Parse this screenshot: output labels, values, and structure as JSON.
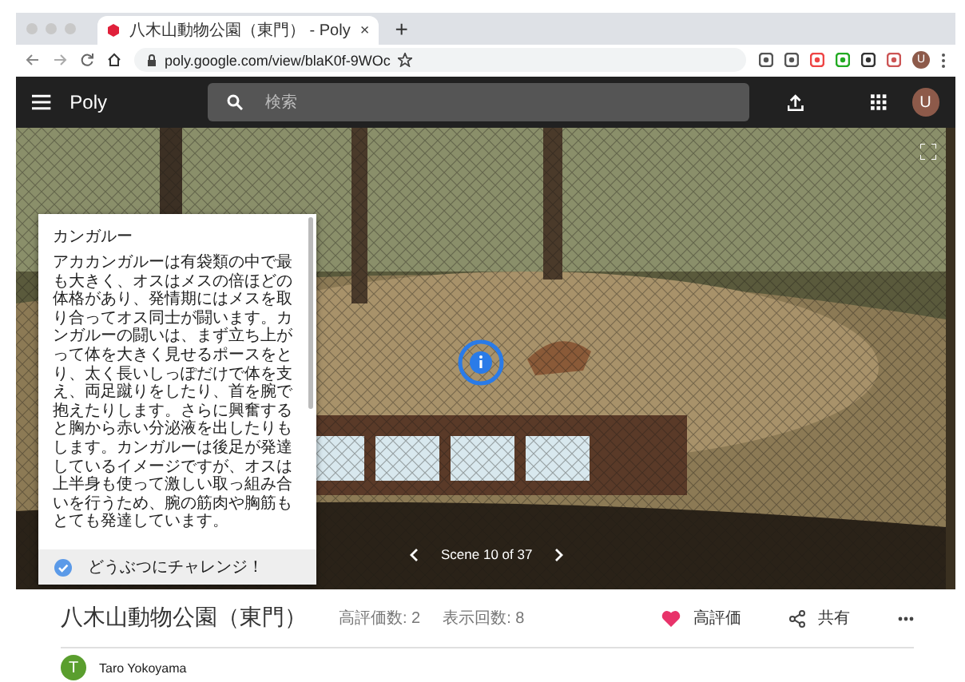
{
  "browser": {
    "tab_title": "八木山動物公園（東門） - Poly",
    "tab_close": "×",
    "new_tab": "+",
    "url": "poly.google.com/view/blaK0f-9WOc",
    "profile_initial": "U"
  },
  "app": {
    "name": "Poly",
    "search": {
      "placeholder": "検索"
    },
    "avatar_initial": "U"
  },
  "viewer": {
    "info_panel": {
      "title": "カンガルー",
      "body": "アカカンガルーは有袋類の中で最も大きく、オスはメスの倍ほどの体格があり、発情期にはメスを取り合ってオス同士が闘います。カンガルーの闘いは、まず立ち上がって体を大きく見せるポースをとり、太く長いしっぽだけで体を支え、両足蹴りをしたり、首を腕で抱えたりします。さらに興奮すると胸から赤い分泌液を出したりもします。カンガルーは後足が発達しているイメージですが、オスは上半身も使って激しい取っ組み合いを行うため、腕の筋肉や胸筋もとても発達しています。",
      "challenge": "どうぶつにチャレンジ！",
      "challenge_checked": true
    },
    "scene_label": "Scene 10 of 37"
  },
  "details": {
    "title": "八木山動物公園（東門）",
    "likes": "高評価数: 2",
    "views": "表示回数: 8",
    "like_button": {
      "label": "高評価",
      "liked": true
    },
    "share_label": "共有"
  },
  "author": {
    "initial": "T",
    "name": "Taro Yokoyama"
  }
}
